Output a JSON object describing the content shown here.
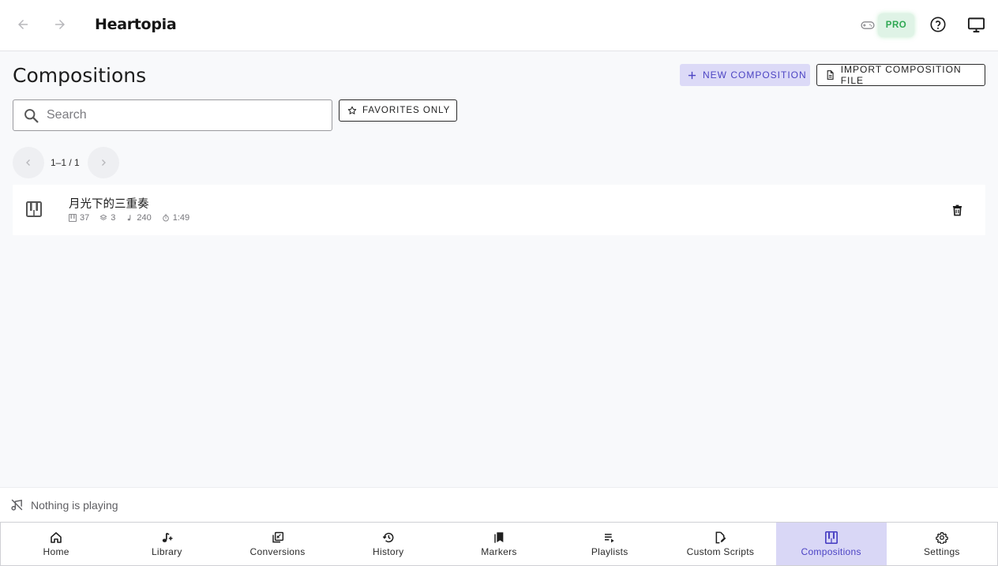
{
  "header": {
    "app_title": "Heartopia",
    "back_icon": "arrow-left-icon",
    "forward_icon": "arrow-right-icon",
    "pro_badge": "PRO",
    "colors": {
      "pro_text": "#2fa853",
      "pro_bg": "#dff3e6"
    }
  },
  "page": {
    "title": "Compositions",
    "new_button_label": "NEW COMPOSITION",
    "import_button_label": "IMPORT COMPOSITION FILE",
    "search_placeholder": "Search",
    "search_value": "",
    "favorites_label": "FAVORITES ONLY",
    "pager_text": "1–1 / 1"
  },
  "compositions": [
    {
      "name": "月光下的三重奏",
      "keys": "37",
      "layers": "3",
      "notes": "240",
      "duration": "1:49"
    }
  ],
  "player": {
    "status": "Nothing is playing"
  },
  "bottom_nav": [
    {
      "label": "Home",
      "icon": "home-icon"
    },
    {
      "label": "Library",
      "icon": "music-add-icon"
    },
    {
      "label": "Conversions",
      "icon": "conversion-icon"
    },
    {
      "label": "History",
      "icon": "history-icon"
    },
    {
      "label": "Markers",
      "icon": "bookmarks-icon"
    },
    {
      "label": "Playlists",
      "icon": "playlist-icon"
    },
    {
      "label": "Custom Scripts",
      "icon": "script-edit-icon"
    },
    {
      "label": "Compositions",
      "icon": "piano-icon",
      "active": true
    },
    {
      "label": "Settings",
      "icon": "gear-icon"
    }
  ],
  "accent_color": "#4b42c4"
}
